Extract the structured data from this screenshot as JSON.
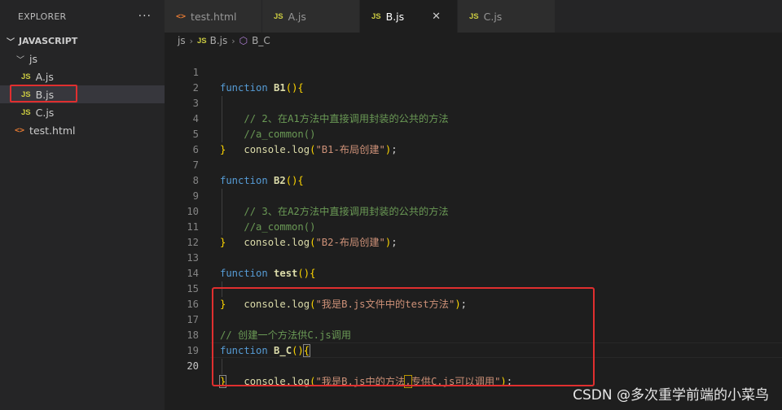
{
  "explorer": {
    "title": "EXPLORER",
    "more": "···",
    "root": "JAVASCRIPT",
    "folder": "js",
    "files": [
      "A.js",
      "B.js",
      "C.js"
    ],
    "html_file": "test.html",
    "badge_js": "JS",
    "badge_html": "<>"
  },
  "tabs": [
    {
      "label": "test.html",
      "icon": "<>"
    },
    {
      "label": "A.js",
      "icon": "JS"
    },
    {
      "label": "B.js",
      "icon": "JS"
    },
    {
      "label": "C.js",
      "icon": "JS"
    }
  ],
  "tab_close": "✕",
  "breadcrumb": {
    "folder": "js",
    "file": "B.js",
    "symbol": "B_C",
    "file_icon": "JS"
  },
  "editor": {
    "line_numbers": [
      "1",
      "2",
      "3",
      "4",
      "5",
      "6",
      "7",
      "8",
      "9",
      "10",
      "11",
      "12",
      "13",
      "14",
      "15",
      "16",
      "17",
      "18",
      "19",
      "20"
    ],
    "tokens": {
      "function": "function",
      "b1": "B1",
      "b2": "B2",
      "test": "test",
      "bc": "B_C",
      "paren_open": "(",
      "paren_close": ")",
      "brace_open": "{",
      "brace_close": "}",
      "console": "console",
      "log": ".log",
      "semicolon": ";",
      "c2": "// 2、在A1方法中直接调用封装的公共的方法",
      "c3": "// 3、在A2方法中直接调用封装的公共的方法",
      "a_common": "//a_common()",
      "s1": "\"B1-布局创建\"",
      "s2": "\"B2-布局创建\"",
      "s3": "\"我是B.js文件中的test方法\"",
      "c17": "// 创建一个方法供C.js调用",
      "s19a": "\"我是B.js中的方法",
      "s19comma": ",",
      "s19b": "专供C.js可以调用\""
    }
  },
  "watermark": "CSDN @多次重学前端的小菜鸟"
}
